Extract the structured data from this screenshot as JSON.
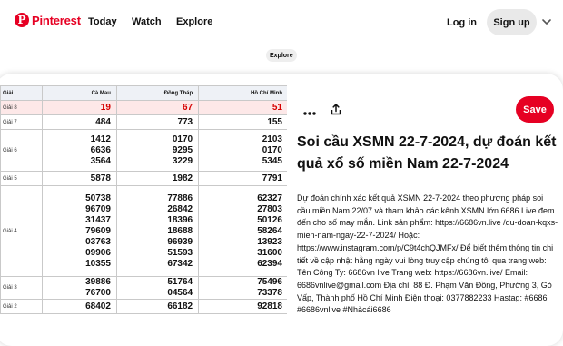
{
  "header": {
    "logo_text": "Pinterest",
    "nav": [
      "Today",
      "Watch",
      "Explore"
    ],
    "login_label": "Log in",
    "signup_label": "Sign up",
    "chevron_icon": "chevron-down-icon"
  },
  "breadcrumb": {
    "label": "Explore"
  },
  "pin": {
    "actions": {
      "more_icon": "more-icon",
      "share_icon": "share-icon",
      "save_label": "Save"
    },
    "title": "Soi cầu XSMN 22-7-2024, dự đoán kết quả xổ số miền Nam 22-7-2024",
    "description": "Dự đoán chính xác kết quả XSMN 22-7-2024 theo phương pháp soi cầu miền Nam 22/07 và tham khảo các kênh XSMN lớn 6686 Live đem đến cho số may mắn. Link sản phẩm: https://6686vn.live /du-doan-kqxs-mien-nam-ngay-22-7-2024/ Hoặc: https://www.instagram.com/p/C9t4chQJMFx/  Để biết thêm thông tin chi tiết về cập nhật hằng ngày vui lòng truy cập chúng tôi qua trang web: Tên Công Ty: 6686vn live Trang web: https://6686vn.live/  Email: 6686vnlive@gmail.com Địa chỉ: 88 Đ. Phạm Văn Đồng, Phường 3, Gò Vấp, Thành phố Hồ Chí Minh Điện thoại: 0377882233 Hastag: #6686 #6686vnlive #Nhàcái6686"
  },
  "table": {
    "headers": [
      "Giải",
      "Cà Mau",
      "Đồng Tháp",
      "Hồ Chí Minh"
    ],
    "rows": [
      {
        "name": "Giải 8",
        "c1": [
          "19"
        ],
        "c2": [
          "67"
        ],
        "c3": [
          "51"
        ]
      },
      {
        "name": "Giải 7",
        "c1": [
          "484"
        ],
        "c2": [
          "773"
        ],
        "c3": [
          "155"
        ]
      },
      {
        "name": "Giải 6",
        "c1": [
          "1412",
          "6636",
          "3564"
        ],
        "c2": [
          "0170",
          "9295",
          "3229"
        ],
        "c3": [
          "2103",
          "0170",
          "5345"
        ]
      },
      {
        "name": "Giải 5",
        "c1": [
          "5878"
        ],
        "c2": [
          "1982"
        ],
        "c3": [
          "7791"
        ]
      },
      {
        "name": "Giải 4",
        "c1": [
          "50738",
          "96709",
          "31437",
          "79609",
          "03763",
          "09906",
          "10355"
        ],
        "c2": [
          "77886",
          "26842",
          "18396",
          "18688",
          "96939",
          "51593",
          "67342"
        ],
        "c3": [
          "62327",
          "27803",
          "50126",
          "58264",
          "13923",
          "31600",
          "62394"
        ]
      },
      {
        "name": "Giải 3",
        "c1": [
          "39886",
          "76700"
        ],
        "c2": [
          "51764",
          "04564"
        ],
        "c3": [
          "75496",
          "73378"
        ]
      },
      {
        "name": "Giải 2",
        "c1": [
          "68402"
        ],
        "c2": [
          "66182"
        ],
        "c3": [
          "92818"
        ]
      }
    ]
  },
  "colors": {
    "brand": "#e60023",
    "prize8": "#d60000",
    "header_bg": "#eef1f6"
  }
}
